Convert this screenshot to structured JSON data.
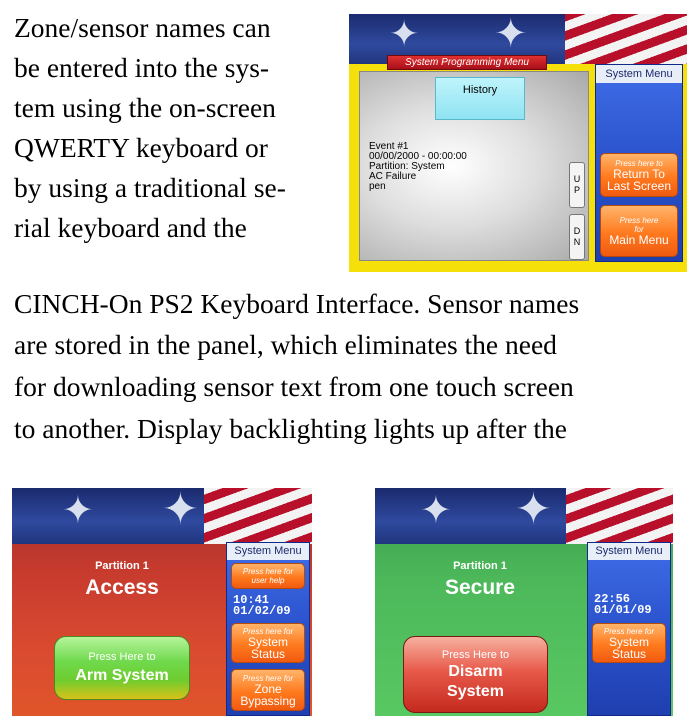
{
  "text_lines": [
    "Zone/sensor names can",
    "be entered into the sys-",
    "tem using the on-screen",
    "QWERTY keyboard or",
    "by using a traditional se-",
    "rial keyboard and the",
    "CINCH-On PS2 Keyboard Interface. Sensor names",
    "are stored in the panel, which eliminates the need",
    "for downloading sensor text from one touch screen",
    "to another. Display backlighting lights up after the"
  ],
  "top_screen": {
    "title": "System Programming Menu",
    "history_button": "History",
    "event_lines": [
      "Event #1",
      "00/00/2000 - 00:00:00",
      "Partition: System",
      "AC Failure",
      "pen"
    ],
    "up_button": [
      "U",
      "P"
    ],
    "down_button": [
      "D",
      "N"
    ],
    "menu_title": "System Menu",
    "return_button": {
      "small": "Press here to",
      "big": [
        "Return To",
        "Last Screen"
      ]
    },
    "main_button": {
      "small": "Press here",
      "small2": "for",
      "big": "Main Menu"
    }
  },
  "left_screen": {
    "partition": "Partition 1",
    "status": "Access",
    "menu_title": "System Menu",
    "help_button": {
      "line1": "Press here for",
      "line2": "user help"
    },
    "time": "10:41",
    "date": "01/02/09",
    "status_button": {
      "small": "Press here for",
      "big": [
        "System",
        "Status"
      ]
    },
    "bypass_button": {
      "small": "Press here for",
      "big": [
        "Zone",
        "Bypassing"
      ]
    },
    "arm_button": {
      "line1": "Press Here to",
      "line2": "Arm System"
    }
  },
  "right_screen": {
    "partition": "Partition 1",
    "status": "Secure",
    "menu_title": "System Menu",
    "time": "22:56",
    "date": "01/01/09",
    "status_button": {
      "small": "Press here for",
      "big": [
        "System",
        "Status"
      ]
    },
    "disarm_button": {
      "line1": "Press Here to",
      "line2": [
        "Disarm",
        "System"
      ]
    }
  },
  "colors": {
    "top_bezel": "#f5e00a",
    "menu_blue": "#2a52cc",
    "button_orange": "#ff7a1e",
    "access_red": "#c63a2e",
    "secure_green": "#4cb85a"
  }
}
